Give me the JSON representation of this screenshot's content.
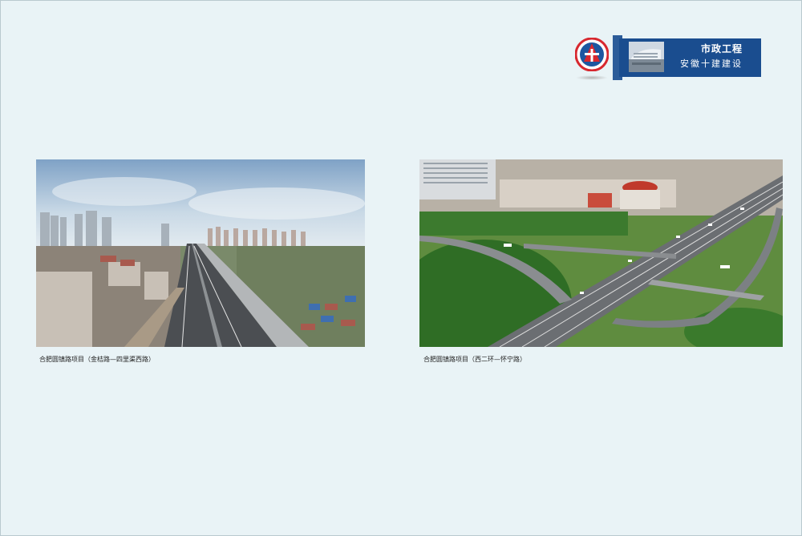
{
  "header": {
    "title": "市政工程",
    "subtitle": "安徽十建建设",
    "logo_icon": "company-logo-icon",
    "colors": {
      "badge": "#1a4d8f",
      "logo_red": "#d7282f",
      "logo_blue": "#1d57a0"
    }
  },
  "projects": [
    {
      "caption": "合肥圆镇路项目（金桔路—四里渠西路）",
      "image": "aerial-highway-city-photo"
    },
    {
      "caption": "合肥圆镇路项目（西二环—怀宁路）",
      "image": "aerial-interchange-rendering"
    }
  ]
}
